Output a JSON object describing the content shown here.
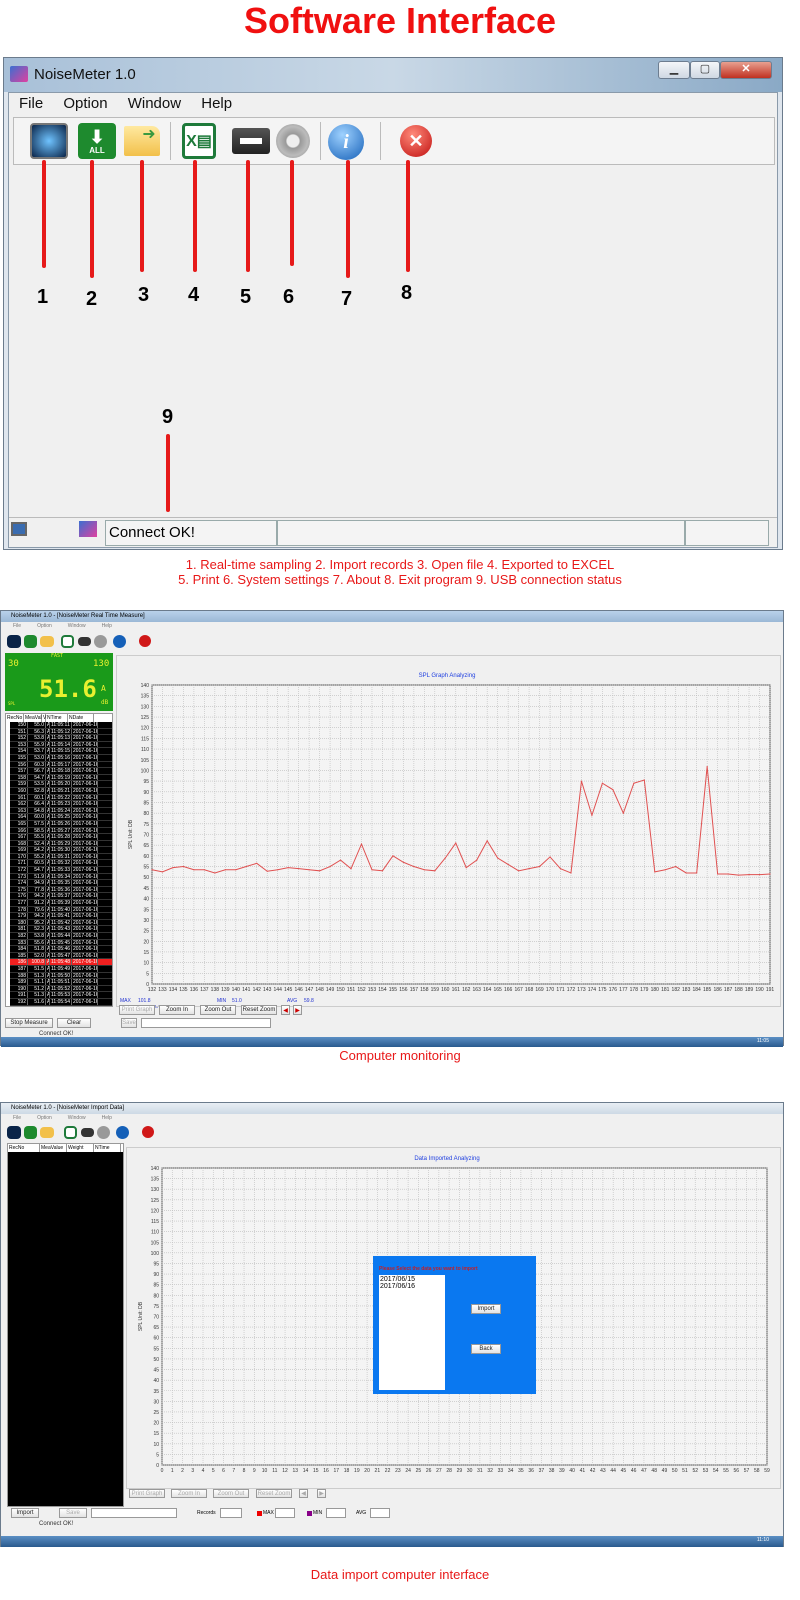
{
  "hero_title": "Software Interface",
  "win1": {
    "title": "NoiseMeter 1.0",
    "menu": [
      "File",
      "Option",
      "Window",
      "Help"
    ],
    "toolbar_icons": [
      "realtime-sampling-icon",
      "import-records-icon",
      "open-file-icon",
      "excel-export-icon",
      "print-icon",
      "settings-gear-icon",
      "about-info-icon",
      "exit-icon"
    ],
    "import_badge": "ALL",
    "callouts": [
      "1",
      "2",
      "3",
      "4",
      "5",
      "6",
      "7",
      "8",
      "9"
    ],
    "status": "Connect OK!"
  },
  "legend": [
    "1. Real-time sampling 2. Import records  3. Open file  4. Exported to EXCEL",
    "5. Print  6. System settings  7. About 8. Exit program  9. USB connection status"
  ],
  "win2": {
    "title": "NoiseMeter 1.0 - [NoiseMeter Real Time Measure]",
    "menu": [
      "File",
      "Option",
      "Window",
      "Help"
    ],
    "lcd": {
      "mode": "FAST",
      "range_low": "30",
      "range_high": "130",
      "value": "51.6",
      "weight": "A",
      "unit": "dB",
      "label": "SPL"
    },
    "columns": [
      "RecNo",
      "MeaVal",
      "V",
      "NTime",
      "NDate"
    ],
    "rows": [
      [
        "150",
        "55.0",
        "A",
        "11:05:11",
        "2017-06-16"
      ],
      [
        "151",
        "56.3",
        "A",
        "11:05:12",
        "2017-06-16"
      ],
      [
        "152",
        "53.8",
        "A",
        "11:05:13",
        "2017-06-16"
      ],
      [
        "153",
        "55.9",
        "A",
        "11:05:14",
        "2017-06-16"
      ],
      [
        "154",
        "53.7",
        "A",
        "11:05:15",
        "2017-06-16"
      ],
      [
        "155",
        "53.0",
        "A",
        "11:05:16",
        "2017-06-16"
      ],
      [
        "156",
        "60.3",
        "A",
        "11:05:17",
        "2017-06-16"
      ],
      [
        "157",
        "56.7",
        "A",
        "11:05:18",
        "2017-06-16"
      ],
      [
        "158",
        "54.7",
        "A",
        "11:05:19",
        "2017-06-16"
      ],
      [
        "159",
        "53.5",
        "A",
        "11:05:20",
        "2017-06-16"
      ],
      [
        "160",
        "52.8",
        "A",
        "11:05:21",
        "2017-06-16"
      ],
      [
        "161",
        "60.1",
        "A",
        "11:05:22",
        "2017-06-16"
      ],
      [
        "162",
        "66.4",
        "A",
        "11:05:23",
        "2017-06-16"
      ],
      [
        "163",
        "54.8",
        "A",
        "11:05:24",
        "2017-06-16"
      ],
      [
        "164",
        "60.0",
        "A",
        "11:05:25",
        "2017-06-16"
      ],
      [
        "165",
        "57.5",
        "A",
        "11:05:26",
        "2017-06-16"
      ],
      [
        "166",
        "58.5",
        "A",
        "11:05:27",
        "2017-06-16"
      ],
      [
        "167",
        "55.5",
        "A",
        "11:05:28",
        "2017-06-16"
      ],
      [
        "168",
        "52.4",
        "A",
        "11:05:29",
        "2017-06-16"
      ],
      [
        "169",
        "54.2",
        "A",
        "11:05:30",
        "2017-06-16"
      ],
      [
        "170",
        "55.2",
        "A",
        "11:05:31",
        "2017-06-16"
      ],
      [
        "171",
        "60.5",
        "A",
        "11:05:32",
        "2017-06-16"
      ],
      [
        "172",
        "54.7",
        "A",
        "11:05:33",
        "2017-06-16"
      ],
      [
        "173",
        "51.9",
        "A",
        "11:05:34",
        "2017-06-16"
      ],
      [
        "174",
        "94.9",
        "A",
        "11:05:35",
        "2017-06-16"
      ],
      [
        "175",
        "77.8",
        "A",
        "11:05:36",
        "2017-06-16"
      ],
      [
        "176",
        "94.2",
        "A",
        "11:05:37",
        "2017-06-16"
      ],
      [
        "177",
        "91.2",
        "A",
        "11:05:39",
        "2017-06-16"
      ],
      [
        "178",
        "79.6",
        "A",
        "11:05:40",
        "2017-06-16"
      ],
      [
        "179",
        "94.2",
        "A",
        "11:05:41",
        "2017-06-16"
      ],
      [
        "180",
        "95.2",
        "A",
        "11:05:42",
        "2017-06-16"
      ],
      [
        "181",
        "52.3",
        "A",
        "11:05:43",
        "2017-06-16"
      ],
      [
        "182",
        "53.8",
        "A",
        "11:05:44",
        "2017-06-16"
      ],
      [
        "183",
        "55.6",
        "A",
        "11:05:45",
        "2017-06-16"
      ],
      [
        "184",
        "51.8",
        "A",
        "11:05:46",
        "2017-06-16"
      ],
      [
        "185",
        "52.0",
        "A",
        "11:05:47",
        "2017-06-16"
      ],
      [
        "186",
        "100.8",
        "A",
        "11:05:48",
        "2017-06-16"
      ],
      [
        "187",
        "51.5",
        "A",
        "11:05:49",
        "2017-06-16"
      ],
      [
        "188",
        "51.3",
        "A",
        "11:05:50",
        "2017-06-16"
      ],
      [
        "189",
        "51.1",
        "A",
        "11:05:51",
        "2017-06-16"
      ],
      [
        "190",
        "51.2",
        "A",
        "11:05:52",
        "2017-06-16"
      ],
      [
        "191",
        "51.3",
        "A",
        "11:05:53",
        "2017-06-16"
      ],
      [
        "192",
        "51.6",
        "A",
        "11:05:54",
        "2017-06-16"
      ]
    ],
    "selected_row": "186",
    "stats": {
      "max_label": "MAX",
      "max": "101.8",
      "min_label": "MIN",
      "min": "51.0",
      "avg_label": "AVG",
      "avg": "59.8",
      "date_label": "Date",
      "date": "2017-06-16"
    },
    "graph_buttons": [
      "Print Graph",
      "Zoom In",
      "Zoom Out",
      "Reset Zoom"
    ],
    "bottom_buttons": [
      "Stop Measure",
      "Clear",
      "Save"
    ],
    "status": "Connect OK!",
    "clock": "11:05"
  },
  "caption2": "Computer monitoring",
  "win3": {
    "title": "NoiseMeter 1.0 - [NoiseMeter Import Data]",
    "menu": [
      "File",
      "Option",
      "Window",
      "Help"
    ],
    "columns": [
      "RecNo",
      "MeaValue",
      "Weight",
      "NTime"
    ],
    "dialog": {
      "prompt": "Please Select the data you want to import",
      "dates": [
        "2017/06/15",
        "2017/06/16"
      ],
      "import": "Import",
      "back": "Back"
    },
    "graph_buttons": [
      "Print Graph",
      "Zoom In",
      "Zoom Out",
      "Reset Zoom"
    ],
    "bottom": {
      "import": "Import",
      "save": "Save",
      "records": "Records",
      "max": "MAX",
      "min": "MIN",
      "avg": "AVG"
    },
    "status": "Connect OK!",
    "clock": "11:10"
  },
  "caption3": "Data import computer interface",
  "colors": {
    "accent_red": "#f01010",
    "line": "#e05050",
    "lcd": "#1a9a1a",
    "dialog": "#0a78f0"
  },
  "chart_data": [
    {
      "type": "line",
      "title": "SPL Graph Analyzing",
      "ylabel": "SPL Unit: DB",
      "ylim": [
        0,
        140
      ],
      "yticks_step": 5,
      "grid": true,
      "x": [
        132,
        133,
        134,
        135,
        136,
        137,
        138,
        139,
        140,
        141,
        142,
        143,
        144,
        145,
        146,
        147,
        148,
        149,
        150,
        151,
        152,
        153,
        154,
        155,
        156,
        157,
        158,
        159,
        160,
        161,
        162,
        163,
        164,
        165,
        166,
        167,
        168,
        169,
        170,
        171,
        172,
        173,
        174,
        175,
        176,
        177,
        178,
        179,
        180,
        181,
        182,
        183,
        184,
        185,
        186,
        187,
        188,
        189,
        190,
        191
      ],
      "values": [
        53.5,
        52.5,
        54.5,
        55,
        53.5,
        53.5,
        52,
        53.5,
        53.5,
        55,
        56.5,
        52.8,
        53.5,
        54.5,
        54,
        53.5,
        53,
        55,
        58,
        54,
        65.5,
        53.5,
        53,
        60,
        57,
        55,
        53.5,
        53,
        59,
        66,
        54.5,
        58,
        67,
        59,
        56,
        53,
        54,
        55,
        59.5,
        54,
        52,
        95,
        79,
        94,
        91,
        80,
        94,
        95.5,
        52.5,
        53.5,
        55,
        52,
        52,
        101.8,
        51.5,
        51.5,
        51,
        51.2,
        51.2,
        51.5
      ]
    },
    {
      "type": "line",
      "title": "Data Imported  Analyzing",
      "ylabel": "SPL Unit: DB",
      "ylim": [
        0,
        140
      ],
      "yticks_step": 5,
      "grid": true,
      "x": [
        0,
        1,
        2,
        3,
        4,
        5,
        6,
        7,
        8,
        9,
        10,
        11,
        12,
        13,
        14,
        15,
        16,
        17,
        18,
        19,
        20,
        21,
        22,
        23,
        24,
        25,
        26,
        27,
        28,
        29,
        30,
        31,
        32,
        33,
        34,
        35,
        36,
        37,
        38,
        39,
        40,
        41,
        42,
        43,
        44,
        45,
        46,
        47,
        48,
        49,
        50,
        51,
        52,
        53,
        54,
        55,
        56,
        57,
        58,
        59
      ],
      "values": []
    }
  ]
}
